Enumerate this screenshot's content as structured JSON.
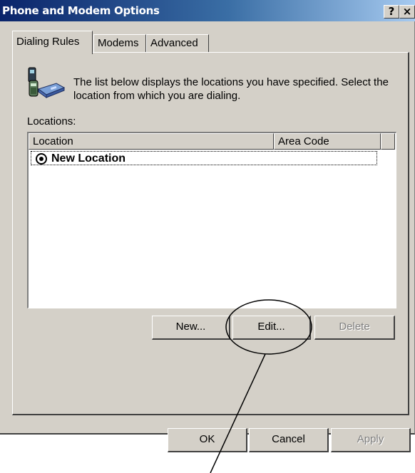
{
  "window": {
    "title": "Phone and Modem Options",
    "help_label": "?",
    "close_label": "×"
  },
  "tabs": [
    {
      "label": "Dialing Rules",
      "active": true
    },
    {
      "label": "Modems",
      "active": false
    },
    {
      "label": "Advanced",
      "active": false
    }
  ],
  "dialing_rules": {
    "description": "The list below displays the locations you have specified. Select the location from which you are dialing.",
    "locations_label": "Locations:",
    "columns": [
      "Location",
      "Area Code",
      ""
    ],
    "rows": [
      {
        "location": "New Location",
        "area_code": "",
        "selected": true
      }
    ],
    "buttons": {
      "new": "New...",
      "edit": "Edit...",
      "delete": "Delete"
    }
  },
  "footer_buttons": {
    "ok": "OK",
    "cancel": "Cancel",
    "apply": "Apply"
  },
  "colors": {
    "dialog_face": "#d4d0c8",
    "title_gradient_start": "#0a246a",
    "title_gradient_end": "#a6caf0",
    "disabled_text": "#808080"
  },
  "icons": {
    "dialing": "phone-modem-icon",
    "selected_location": "radio-selected-icon"
  }
}
